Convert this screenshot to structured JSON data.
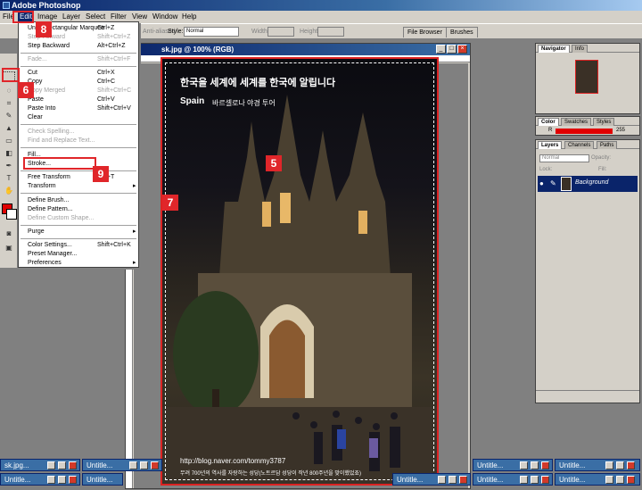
{
  "app": {
    "title": "Adobe Photoshop"
  },
  "menubar": {
    "items": [
      "File",
      "Edit",
      "Image",
      "Layer",
      "Select",
      "Filter",
      "View",
      "Window",
      "Help"
    ]
  },
  "options_bar": {
    "antialias_label": "Anti-aliased",
    "style_label": "Style:",
    "style_value": "Normal",
    "width_label": "Width:",
    "height_label": "Height:",
    "tab_file_browser": "File Browser",
    "tab_brushes": "Brushes"
  },
  "edit_menu": {
    "items": [
      {
        "label": "Undo Rectangular Marquee",
        "shortcut": "Ctrl+Z",
        "disabled": false
      },
      {
        "label": "Step Forward",
        "shortcut": "Shift+Ctrl+Z",
        "disabled": true
      },
      {
        "label": "Step Backward",
        "shortcut": "Alt+Ctrl+Z",
        "disabled": false
      },
      {
        "label": "Fade...",
        "shortcut": "Shift+Ctrl+F",
        "disabled": true
      },
      {
        "label": "Cut",
        "shortcut": "Ctrl+X",
        "disabled": false
      },
      {
        "label": "Copy",
        "shortcut": "Ctrl+C",
        "disabled": false
      },
      {
        "label": "Copy Merged",
        "shortcut": "Shift+Ctrl+C",
        "disabled": true
      },
      {
        "label": "Paste",
        "shortcut": "Ctrl+V",
        "disabled": false
      },
      {
        "label": "Paste Into",
        "shortcut": "Shift+Ctrl+V",
        "disabled": false
      },
      {
        "label": "Clear",
        "shortcut": "",
        "disabled": false
      },
      {
        "label": "Check Spelling...",
        "shortcut": "",
        "disabled": true
      },
      {
        "label": "Find and Replace Text...",
        "shortcut": "",
        "disabled": true
      },
      {
        "label": "Fill...",
        "shortcut": "",
        "disabled": false
      },
      {
        "label": "Stroke...",
        "shortcut": "",
        "disabled": false
      },
      {
        "label": "Free Transform",
        "shortcut": "Ctrl+T",
        "disabled": false
      },
      {
        "label": "Transform",
        "shortcut": "",
        "disabled": false,
        "submenu": true
      },
      {
        "label": "Define Brush...",
        "shortcut": "",
        "disabled": false
      },
      {
        "label": "Define Pattern...",
        "shortcut": "",
        "disabled": false
      },
      {
        "label": "Define Custom Shape...",
        "shortcut": "",
        "disabled": true
      },
      {
        "label": "Purge",
        "shortcut": "",
        "disabled": false,
        "submenu": true
      },
      {
        "label": "Color Settings...",
        "shortcut": "Shift+Ctrl+K",
        "disabled": false
      },
      {
        "label": "Preset Manager...",
        "shortcut": "",
        "disabled": false
      },
      {
        "label": "Preferences",
        "shortcut": "",
        "disabled": false,
        "submenu": true
      }
    ]
  },
  "document": {
    "title": "sk.jpg @ 100% (RGB)"
  },
  "photo": {
    "title": "한국을 세계에 세계를 한국에 알립니다",
    "country": "Spain",
    "subtitle": "바르셀로나 야경 투어",
    "url": "http://blog.naver.com/tommy3787",
    "caption": "무려 700년의 역사를 자랑하는 성당(노트르담 성당이 작년 800주년을 맞이했었죠)"
  },
  "callouts": {
    "badge_5": "5",
    "badge_6": "6",
    "badge_7": "7",
    "badge_8": "8",
    "badge_9": "9"
  },
  "navigator": {
    "tabs": [
      "Navigator",
      "Info"
    ]
  },
  "color_panel": {
    "tabs": [
      "Color",
      "Swatches",
      "Styles"
    ],
    "r_label": "R",
    "r_value": "255"
  },
  "layers_panel": {
    "tabs": [
      "Layers",
      "Channels",
      "Paths"
    ],
    "blend_mode": "Normal",
    "opacity_label": "Opacity:",
    "fill_label": "Fill:",
    "lock_label": "Lock:",
    "layer_name": "Background"
  },
  "taskbar": {
    "items": [
      "sk.jpg...",
      "Untitle...",
      "Untitle...",
      "Untitle...",
      "Untitle...",
      "Untitle...",
      "Untitle...",
      "Untitle...",
      "Untitle..."
    ]
  },
  "colors": {
    "accent_red": "#e0262a",
    "titlebar_blue": "#0a246a",
    "menu_gray": "#d4d0c8"
  }
}
